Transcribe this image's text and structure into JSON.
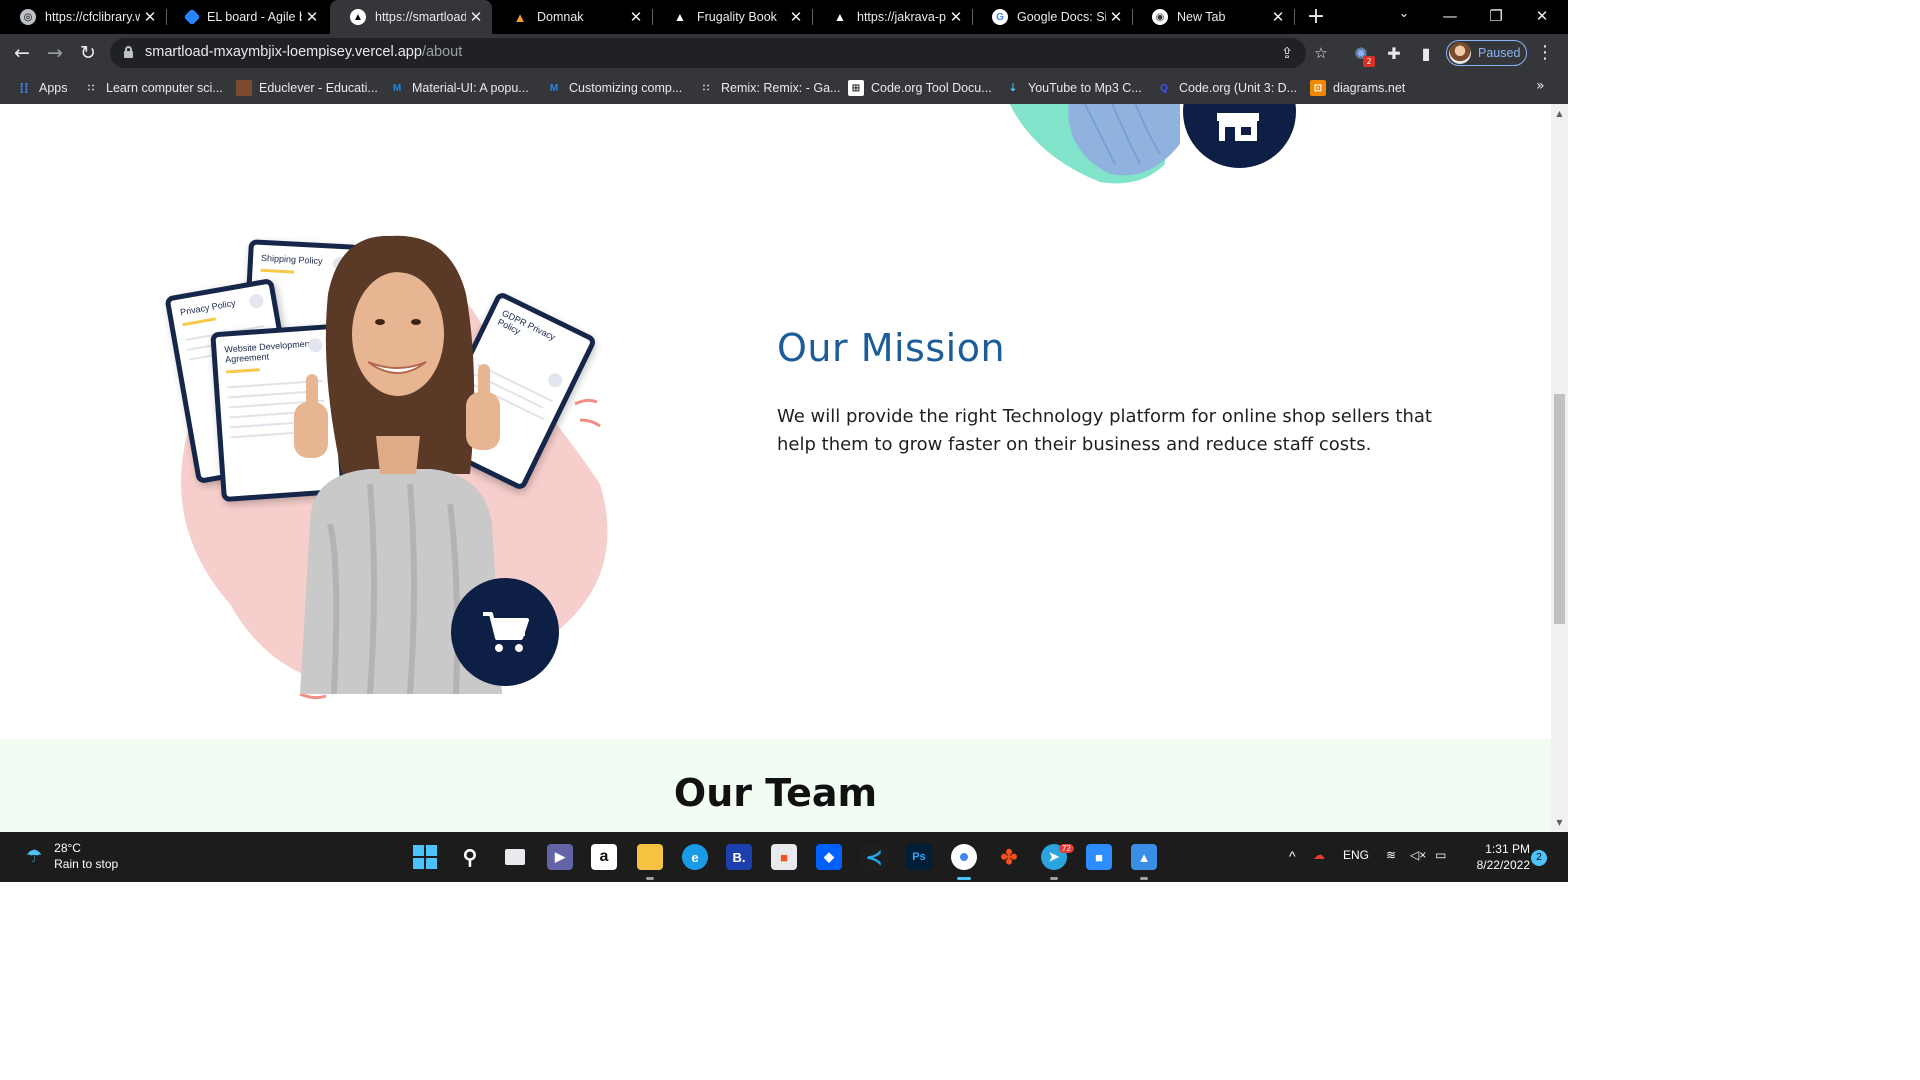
{
  "browser": {
    "tabs": [
      {
        "title": "https://cfclibrary.w",
        "active": false
      },
      {
        "title": "EL board - Agile b",
        "active": false
      },
      {
        "title": "https://smartload",
        "active": true
      },
      {
        "title": "Domnak",
        "active": false
      },
      {
        "title": "Frugality Book",
        "active": false
      },
      {
        "title": "https://jakrava-pl",
        "active": false
      },
      {
        "title": "Google Docs: Sig",
        "active": false
      },
      {
        "title": "New Tab",
        "active": false
      }
    ],
    "address": {
      "host": "smartload-mxaymbjix-loempisey.vercel.app",
      "path": "/about"
    },
    "profile_status": "Paused",
    "extension_badge": "2",
    "bookmarks": [
      {
        "label": "Apps"
      },
      {
        "label": "Learn computer sci..."
      },
      {
        "label": "Educlever - Educati..."
      },
      {
        "label": "Material-UI: A popu..."
      },
      {
        "label": "Customizing comp..."
      },
      {
        "label": "Remix: Remix: - Ga..."
      },
      {
        "label": "Code.org Tool Docu..."
      },
      {
        "label": "YouTube to Mp3 C..."
      },
      {
        "label": "Code.org (Unit 3: D..."
      },
      {
        "label": "diagrams.net"
      }
    ],
    "bookmarks_more": "»"
  },
  "page": {
    "mission": {
      "title": "Our Mission",
      "text": "We will provide the right Technology platform for online shop sellers that help them to grow faster on their business and reduce staff costs."
    },
    "illustration": {
      "docs": [
        "Shipping Policy",
        "Privacy Policy",
        "Website Development Agreement",
        "GDPR Privacy Policy"
      ]
    },
    "team": {
      "title": "Our Team"
    }
  },
  "taskbar": {
    "weather": {
      "temp": "28°C",
      "desc": "Rain to stop"
    },
    "tray": {
      "language": "ENG",
      "time": "1:31 PM",
      "date": "8/22/2022",
      "notifications": "2",
      "telegram_badge": "72"
    }
  },
  "colors": {
    "accent_blue": "#1c5d99",
    "navy": "#0e1f45",
    "team_band": "#f1fcf3",
    "blob_pink": "#f4c7c3",
    "mint": "#7fe0c7"
  }
}
